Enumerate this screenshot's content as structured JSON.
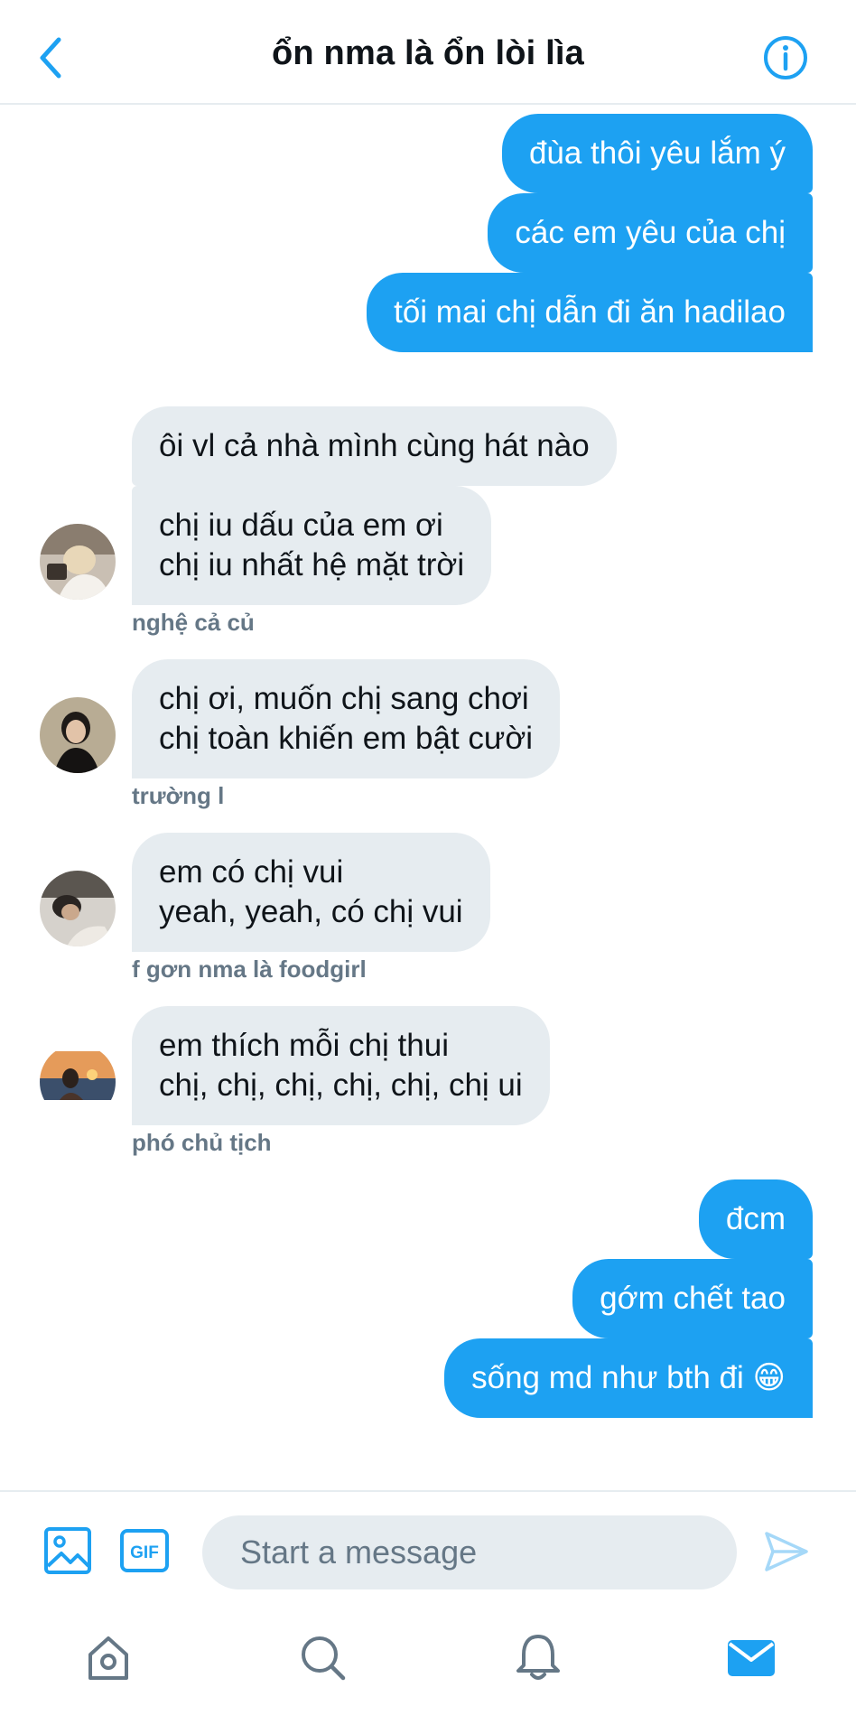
{
  "header": {
    "title": "ổn nma là ổn lòi lìa"
  },
  "messages": {
    "m1": "đùa thôi yêu lắm ý",
    "m2": "các em yêu của chị",
    "m3": "tối mai chị dẫn đi ăn hadilao",
    "m4": "ôi vl cả nhà mình cùng hát nào",
    "m5": "chị iu dấu của em ơi\nchị iu nhất hệ mặt trời",
    "m6": "chị ơi, muốn chị sang chơi\nchị toàn khiến em bật cười",
    "m7": "em có chị vui\nyeah, yeah, có chị vui",
    "m8": "em thích mỗi chị thui\nchị, chị, chị, chị, chị, chị ui",
    "m9": "đcm",
    "m10": "gớm chết tao",
    "m11": "sống md như bth đi 😁"
  },
  "senders": {
    "s1": "nghệ cả củ",
    "s2": "trường l",
    "s3": "f gơn nma là foodgirl",
    "s4": "phó chủ tịch"
  },
  "composer": {
    "placeholder": "Start a message"
  },
  "icons": {
    "back": "chevron-left-icon",
    "info": "info-icon",
    "image": "image-icon",
    "gif": "gif-icon",
    "send": "send-icon",
    "home": "home-icon",
    "search": "search-icon",
    "notifications": "bell-icon",
    "messages": "mail-icon"
  },
  "colors": {
    "accent": "#1da1f2",
    "incoming_bubble": "#e6ecf0",
    "secondary_text": "#657786"
  }
}
